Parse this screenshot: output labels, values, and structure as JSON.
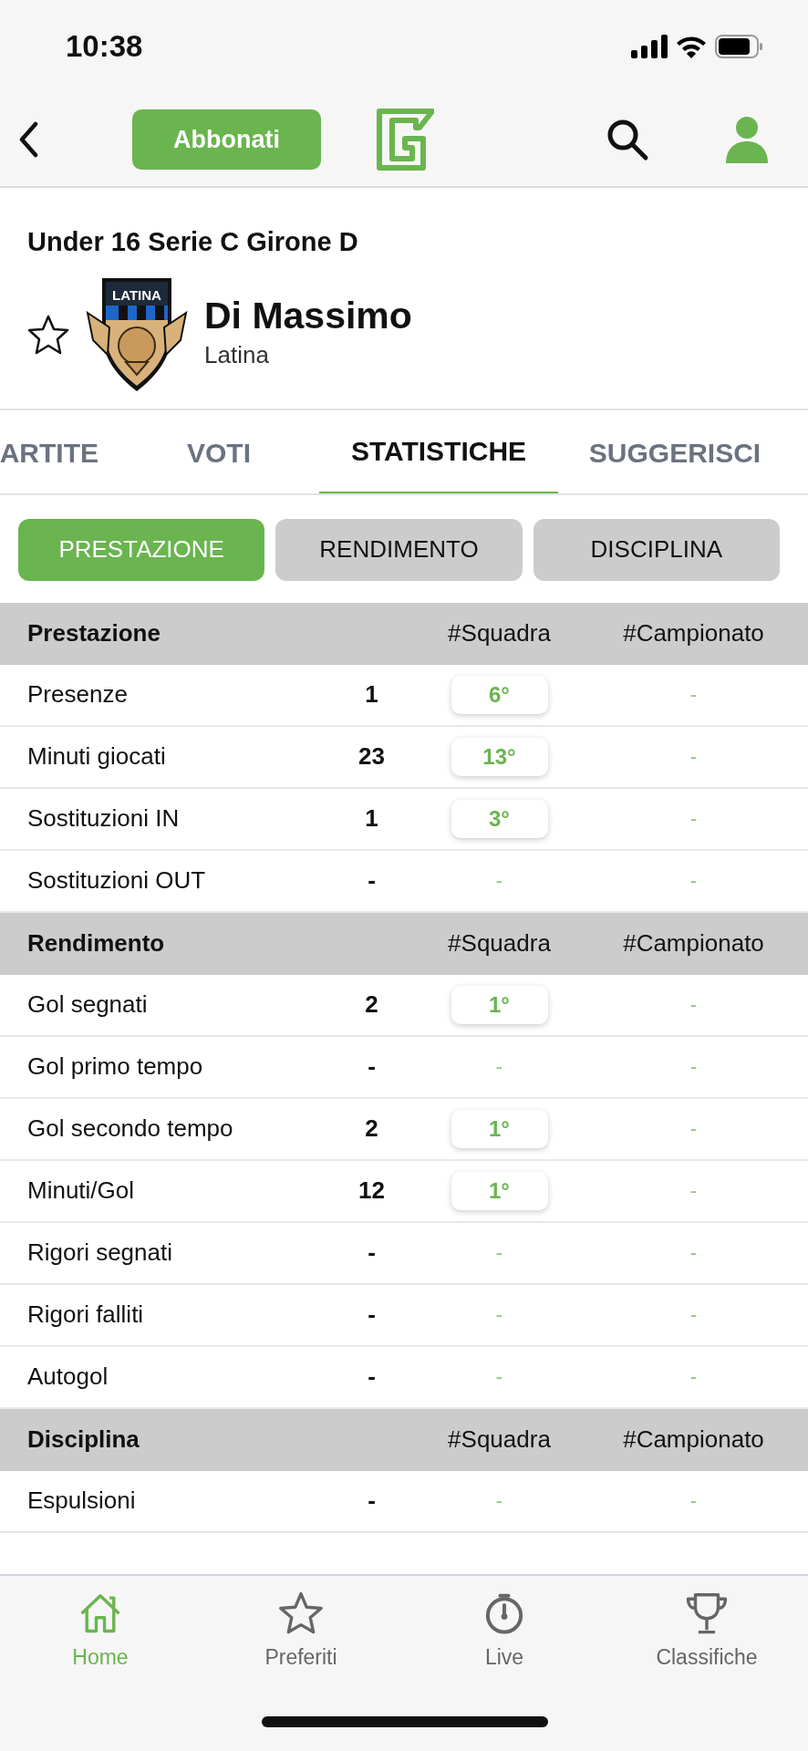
{
  "status_bar": {
    "time": "10:38"
  },
  "header": {
    "subscribe_button": "Abbonati"
  },
  "competition": "Under 16 Serie C  Girone D",
  "player": {
    "name": "Di Massimo",
    "team": "Latina",
    "crest_label": "LATINA",
    "favorite": false
  },
  "tabs": [
    {
      "label": "ARTITE",
      "selected": false
    },
    {
      "label": "VOTI",
      "selected": false
    },
    {
      "label": "STATISTICHE",
      "selected": true
    },
    {
      "label": "SUGGERISCI",
      "selected": false
    }
  ],
  "sub_tabs": [
    {
      "label": "PRESTAZIONE",
      "selected": true
    },
    {
      "label": "RENDIMENTO",
      "selected": false
    },
    {
      "label": "DISCIPLINA",
      "selected": false
    }
  ],
  "sections": [
    {
      "title": "Prestazione",
      "columns": [
        "#Squadra",
        "#Campionato"
      ],
      "rows": [
        {
          "label": "Presenze",
          "value": "1",
          "team_rank": "6°",
          "ranked": true,
          "league_rank": "-"
        },
        {
          "label": "Minuti giocati",
          "value": "23",
          "team_rank": "13°",
          "ranked": true,
          "league_rank": "-"
        },
        {
          "label": "Sostituzioni IN",
          "value": "1",
          "team_rank": "3°",
          "ranked": true,
          "league_rank": "-"
        },
        {
          "label": "Sostituzioni OUT",
          "value": "-",
          "team_rank": "-",
          "ranked": false,
          "league_rank": "-"
        }
      ]
    },
    {
      "title": "Rendimento",
      "columns": [
        "#Squadra",
        "#Campionato"
      ],
      "rows": [
        {
          "label": "Gol segnati",
          "value": "2",
          "team_rank": "1°",
          "ranked": true,
          "league_rank": "-"
        },
        {
          "label": "Gol primo tempo",
          "value": "-",
          "team_rank": "-",
          "ranked": false,
          "league_rank": "-"
        },
        {
          "label": "Gol secondo tempo",
          "value": "2",
          "team_rank": "1°",
          "ranked": true,
          "league_rank": "-"
        },
        {
          "label": "Minuti/Gol",
          "value": "12",
          "team_rank": "1°",
          "ranked": true,
          "league_rank": "-"
        },
        {
          "label": "Rigori segnati",
          "value": "-",
          "team_rank": "-",
          "ranked": false,
          "league_rank": "-"
        },
        {
          "label": "Rigori falliti",
          "value": "-",
          "team_rank": "-",
          "ranked": false,
          "league_rank": "-"
        },
        {
          "label": "Autogol",
          "value": "-",
          "team_rank": "-",
          "ranked": false,
          "league_rank": "-"
        }
      ]
    },
    {
      "title": "Disciplina",
      "columns": [
        "#Squadra",
        "#Campionato"
      ],
      "rows": [
        {
          "label": "Espulsioni",
          "value": "-",
          "team_rank": "-",
          "ranked": false,
          "league_rank": "-"
        }
      ]
    }
  ],
  "bottom_nav": [
    {
      "label": "Home",
      "selected": true
    },
    {
      "label": "Preferiti",
      "selected": false
    },
    {
      "label": "Live",
      "selected": false
    },
    {
      "label": "Classifiche",
      "selected": false
    }
  ]
}
